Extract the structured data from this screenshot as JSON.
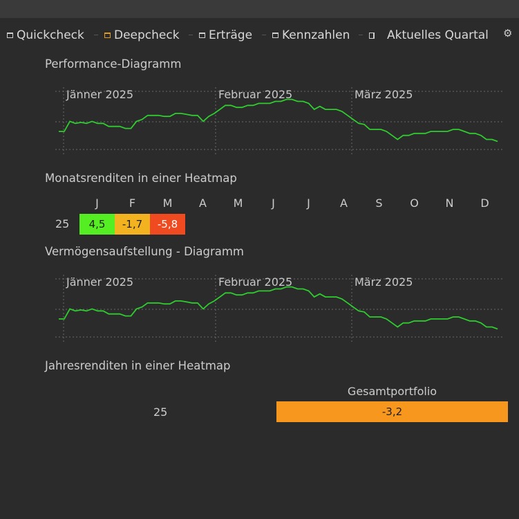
{
  "tabs": [
    {
      "label": "Quickcheck",
      "icon": "window-icon"
    },
    {
      "label": "Deepcheck",
      "icon": "window-icon"
    },
    {
      "label": "Erträge",
      "icon": "window-icon"
    },
    {
      "label": "Kennzahlen",
      "icon": "window-icon"
    },
    {
      "label": "Aktuelles Quartal",
      "icon": "document-icon"
    }
  ],
  "settings_icon": "gear-icon",
  "sections": {
    "performance": "Performance-Diagramm",
    "monthly_heatmap": "Monatsrenditen in einer Heatmap",
    "asset_allocation": "Vermögensaufstellung - Diagramm",
    "yearly_heatmap": "Jahresrenditen in einer Heatmap"
  },
  "colors": {
    "line": "#2ecc2e",
    "positive": "#55ee22",
    "slight_negative": "#f3b320",
    "negative": "#f04a20",
    "portfolio": "#f7971d"
  },
  "chart_data": [
    {
      "type": "line",
      "month_labels": [
        "Jänner 2025",
        "Februar 2025",
        "März 2025"
      ],
      "grid": true,
      "values": [
        50,
        50,
        60,
        58,
        59,
        58,
        60,
        58,
        58,
        55,
        55,
        55,
        53,
        53,
        60,
        62,
        66,
        66,
        66,
        65,
        65,
        68,
        68,
        67,
        66,
        66,
        60,
        65,
        68,
        72,
        76,
        76,
        74,
        74,
        76,
        76,
        78,
        78,
        78,
        80,
        80,
        82,
        82,
        80,
        80,
        78,
        72,
        75,
        72,
        72,
        72,
        70,
        66,
        62,
        58,
        57,
        52,
        52,
        52,
        50,
        46,
        42,
        46,
        46,
        48,
        48,
        48,
        50,
        50,
        50,
        50,
        52,
        52,
        50,
        48,
        48,
        46,
        42,
        42,
        40
      ]
    },
    {
      "type": "heatmap",
      "columns": [
        "J",
        "F",
        "M",
        "A",
        "M",
        "J",
        "J",
        "A",
        "S",
        "O",
        "N",
        "D"
      ],
      "rows": [
        {
          "label": "25",
          "values": [
            "4,5",
            "-1,7",
            "-5,8"
          ]
        }
      ]
    },
    {
      "type": "line",
      "month_labels": [
        "Jänner 2025",
        "Februar 2025",
        "März 2025"
      ],
      "grid": true,
      "values": [
        50,
        50,
        60,
        58,
        59,
        58,
        60,
        58,
        58,
        55,
        55,
        55,
        53,
        53,
        60,
        62,
        66,
        66,
        66,
        65,
        65,
        68,
        68,
        67,
        66,
        66,
        60,
        65,
        68,
        72,
        76,
        76,
        74,
        74,
        76,
        76,
        78,
        78,
        78,
        80,
        80,
        82,
        82,
        80,
        80,
        78,
        72,
        75,
        72,
        72,
        72,
        70,
        66,
        62,
        58,
        57,
        52,
        52,
        52,
        50,
        46,
        42,
        46,
        46,
        48,
        48,
        48,
        50,
        50,
        50,
        50,
        52,
        52,
        50,
        48,
        48,
        46,
        42,
        42,
        40
      ]
    },
    {
      "type": "heatmap",
      "column_header": "Gesamtportfolio",
      "rows": [
        {
          "label": "25",
          "value": "-3,2"
        }
      ]
    }
  ]
}
